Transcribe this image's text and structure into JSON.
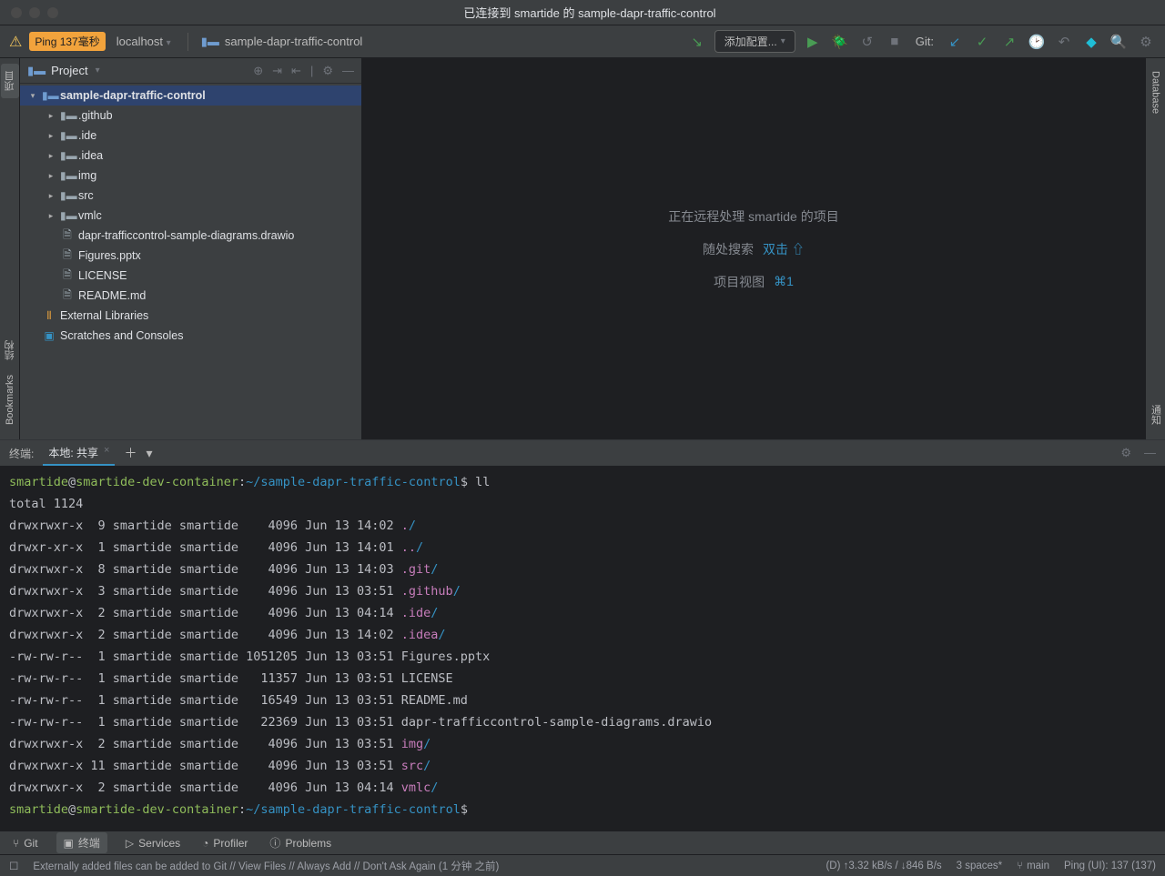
{
  "window": {
    "title": "已连接到 smartide 的 sample-dapr-traffic-control"
  },
  "toolbar": {
    "ping": "Ping 137毫秒",
    "host": "localhost",
    "breadcrumb": "sample-dapr-traffic-control",
    "config_btn": "添加配置...",
    "git_label": "Git:"
  },
  "left_tabs": {
    "project": "项目"
  },
  "right_tabs": {
    "database": "Database",
    "notify": "通知"
  },
  "project_pane": {
    "title": "Project",
    "tree": {
      "root": "sample-dapr-traffic-control",
      "folders": [
        ".github",
        ".ide",
        ".idea",
        "img",
        "src",
        "vmlc"
      ],
      "files": [
        "dapr-trafficcontrol-sample-diagrams.drawio",
        "Figures.pptx",
        "LICENSE",
        "README.md"
      ],
      "external": "External Libraries",
      "scratches": "Scratches and Consoles"
    }
  },
  "editor": {
    "line1": "正在远程处理 smartide 的项目",
    "line2_l": "随处搜索",
    "line2_r": "双击 ⇧",
    "line3_l": "项目视图",
    "line3_r": "⌘1"
  },
  "terminal": {
    "label": "终端:",
    "tab": "本地: 共享",
    "prompt": {
      "user": "smartide",
      "host": "smartide-dev-container",
      "path": "~/sample-dapr-traffic-control",
      "sign": "$"
    },
    "cmd1": "ll",
    "total": "total 1124",
    "rows": [
      {
        "perm": "drwxrwxr-x",
        "n": "9",
        "u": "smartide",
        "g": "smartide",
        "size": "4096",
        "date": "Jun 13 14:02",
        "name": "./",
        "dir": true
      },
      {
        "perm": "drwxr-xr-x",
        "n": "1",
        "u": "smartide",
        "g": "smartide",
        "size": "4096",
        "date": "Jun 13 14:01",
        "name": "../",
        "dir": true
      },
      {
        "perm": "drwxrwxr-x",
        "n": "8",
        "u": "smartide",
        "g": "smartide",
        "size": "4096",
        "date": "Jun 13 14:03",
        "name": ".git/",
        "dir": true
      },
      {
        "perm": "drwxrwxr-x",
        "n": "3",
        "u": "smartide",
        "g": "smartide",
        "size": "4096",
        "date": "Jun 13 03:51",
        "name": ".github/",
        "dir": true
      },
      {
        "perm": "drwxrwxr-x",
        "n": "2",
        "u": "smartide",
        "g": "smartide",
        "size": "4096",
        "date": "Jun 13 04:14",
        "name": ".ide/",
        "dir": true
      },
      {
        "perm": "drwxrwxr-x",
        "n": "2",
        "u": "smartide",
        "g": "smartide",
        "size": "4096",
        "date": "Jun 13 14:02",
        "name": ".idea/",
        "dir": true
      },
      {
        "perm": "-rw-rw-r--",
        "n": "1",
        "u": "smartide",
        "g": "smartide",
        "size": "1051205",
        "date": "Jun 13 03:51",
        "name": "Figures.pptx",
        "dir": false
      },
      {
        "perm": "-rw-rw-r--",
        "n": "1",
        "u": "smartide",
        "g": "smartide",
        "size": "11357",
        "date": "Jun 13 03:51",
        "name": "LICENSE",
        "dir": false
      },
      {
        "perm": "-rw-rw-r--",
        "n": "1",
        "u": "smartide",
        "g": "smartide",
        "size": "16549",
        "date": "Jun 13 03:51",
        "name": "README.md",
        "dir": false
      },
      {
        "perm": "-rw-rw-r--",
        "n": "1",
        "u": "smartide",
        "g": "smartide",
        "size": "22369",
        "date": "Jun 13 03:51",
        "name": "dapr-trafficcontrol-sample-diagrams.drawio",
        "dir": false
      },
      {
        "perm": "drwxrwxr-x",
        "n": "2",
        "u": "smartide",
        "g": "smartide",
        "size": "4096",
        "date": "Jun 13 03:51",
        "name": "img/",
        "dir": true
      },
      {
        "perm": "drwxrwxr-x",
        "n": "11",
        "u": "smartide",
        "g": "smartide",
        "size": "4096",
        "date": "Jun 13 03:51",
        "name": "src/",
        "dir": true
      },
      {
        "perm": "drwxrwxr-x",
        "n": "2",
        "u": "smartide",
        "g": "smartide",
        "size": "4096",
        "date": "Jun 13 04:14",
        "name": "vmlc/",
        "dir": true
      }
    ]
  },
  "tool_window_bar": {
    "git": "Git",
    "terminal": "终端",
    "services": "Services",
    "profiler": "Profiler",
    "problems": "Problems"
  },
  "statusbar": {
    "msg": "Externally added files can be added to Git // View Files // Always Add // Don't Ask Again (1 分钟 之前)",
    "net": "(D) ↑3.32 kB/s / ↓846 B/s",
    "spaces": "3 spaces*",
    "branch": "main",
    "ping": "Ping (UI): 137 (137)"
  },
  "left_gutter": {
    "struct": "结构",
    "bookmarks": "Bookmarks"
  }
}
